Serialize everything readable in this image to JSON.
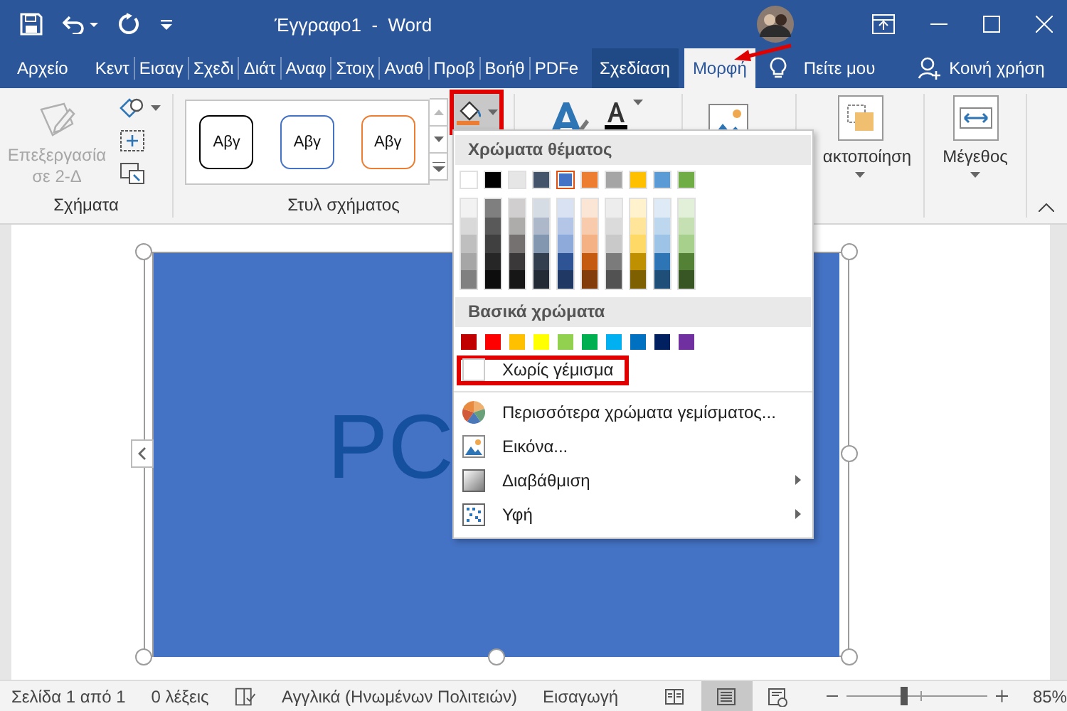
{
  "title_bar": {
    "title": "Έγγραφο1  -  Word"
  },
  "tabs": [
    {
      "label": "Αρχείο",
      "kind": "file",
      "selected": false
    },
    {
      "label": "Κεντ",
      "kind": "normal",
      "selected": false
    },
    {
      "label": "Εισαγ",
      "kind": "normal",
      "selected": false
    },
    {
      "label": "Σχεδι",
      "kind": "normal",
      "selected": false
    },
    {
      "label": "Διάτ",
      "kind": "normal",
      "selected": false
    },
    {
      "label": "Αναφ",
      "kind": "normal",
      "selected": false
    },
    {
      "label": "Στοιχ",
      "kind": "normal",
      "selected": false
    },
    {
      "label": "Αναθ",
      "kind": "normal",
      "selected": false
    },
    {
      "label": "Προβ",
      "kind": "normal",
      "selected": false
    },
    {
      "label": "Βοήθ",
      "kind": "normal",
      "selected": false
    },
    {
      "label": "PDFe",
      "kind": "normal",
      "selected": false
    },
    {
      "label": "Σχεδίαση",
      "kind": "contextual",
      "selected": false
    },
    {
      "label": "Μορφή",
      "kind": "contextual",
      "selected": true
    }
  ],
  "tell_me": {
    "label": "Πείτε μου"
  },
  "share": {
    "label": "Κοινή χρήση"
  },
  "ribbon": {
    "shapes_group": {
      "label": "Σχήματα",
      "edit_button": {
        "label": "Επεξεργασία σε 2-Δ",
        "disabled": true
      }
    },
    "styles_group": {
      "label": "Στυλ σχήματος",
      "styles": [
        {
          "text": "Αβγ",
          "color": "#000000"
        },
        {
          "text": "Αβγ",
          "color": "#4472c4"
        },
        {
          "text": "Αβγ",
          "color": "#ed7d31"
        }
      ],
      "fill_button": {
        "annotated": true
      }
    },
    "arrange": {
      "label": "ακτοποίηση"
    },
    "size": {
      "label": "Μέγεθος"
    }
  },
  "document": {
    "shape_text": "PC"
  },
  "fill_menu": {
    "theme_header": "Χρώματα θέματος",
    "theme_colors": [
      {
        "color": "#ffffff",
        "selected": false,
        "shades": [
          {
            "color": "#f2f2f2"
          },
          {
            "color": "#d9d9d9"
          },
          {
            "color": "#bfbfbf"
          },
          {
            "color": "#a6a6a6"
          },
          {
            "color": "#808080"
          }
        ]
      },
      {
        "color": "#000000",
        "selected": false,
        "shades": [
          {
            "color": "#7f7f7f"
          },
          {
            "color": "#595959"
          },
          {
            "color": "#404040"
          },
          {
            "color": "#262626"
          },
          {
            "color": "#0d0d0d"
          }
        ]
      },
      {
        "color": "#e7e6e6",
        "selected": false,
        "shades": [
          {
            "color": "#d0cece"
          },
          {
            "color": "#aeabab"
          },
          {
            "color": "#767171"
          },
          {
            "color": "#3a3838"
          },
          {
            "color": "#171616"
          }
        ]
      },
      {
        "color": "#44546a",
        "selected": false,
        "shades": [
          {
            "color": "#d6dce4"
          },
          {
            "color": "#adb9ca"
          },
          {
            "color": "#8497b0"
          },
          {
            "color": "#333f4f"
          },
          {
            "color": "#222a35"
          }
        ]
      },
      {
        "color": "#4472c4",
        "selected": true,
        "shades": [
          {
            "color": "#d9e2f3"
          },
          {
            "color": "#b4c6e7"
          },
          {
            "color": "#8eaadb"
          },
          {
            "color": "#2f5496"
          },
          {
            "color": "#1f3864"
          }
        ]
      },
      {
        "color": "#ed7d31",
        "selected": false,
        "shades": [
          {
            "color": "#fbe5d5"
          },
          {
            "color": "#f7cbac"
          },
          {
            "color": "#f4b183"
          },
          {
            "color": "#c55a11"
          },
          {
            "color": "#833c0b"
          }
        ]
      },
      {
        "color": "#a5a5a5",
        "selected": false,
        "shades": [
          {
            "color": "#ededed"
          },
          {
            "color": "#dbdbdb"
          },
          {
            "color": "#c9c9c9"
          },
          {
            "color": "#7b7b7b"
          },
          {
            "color": "#525252"
          }
        ]
      },
      {
        "color": "#ffc000",
        "selected": false,
        "shades": [
          {
            "color": "#fff2cc"
          },
          {
            "color": "#ffe599"
          },
          {
            "color": "#ffd966"
          },
          {
            "color": "#bf9000"
          },
          {
            "color": "#7f6000"
          }
        ]
      },
      {
        "color": "#5b9bd5",
        "selected": false,
        "shades": [
          {
            "color": "#deebf6"
          },
          {
            "color": "#bdd7ee"
          },
          {
            "color": "#9dc3e6"
          },
          {
            "color": "#2e75b5"
          },
          {
            "color": "#1f4e79"
          }
        ]
      },
      {
        "color": "#70ad47",
        "selected": false,
        "shades": [
          {
            "color": "#e2efd9"
          },
          {
            "color": "#c5e0b3"
          },
          {
            "color": "#a8d08d"
          },
          {
            "color": "#538135"
          },
          {
            "color": "#375623"
          }
        ]
      }
    ],
    "standard_header": "Βασικά χρώματα",
    "standard_colors": [
      {
        "color": "#c00000"
      },
      {
        "color": "#ff0000"
      },
      {
        "color": "#ffc000"
      },
      {
        "color": "#ffff00"
      },
      {
        "color": "#92d050"
      },
      {
        "color": "#00b050"
      },
      {
        "color": "#00b0f0"
      },
      {
        "color": "#0070c0"
      },
      {
        "color": "#002060"
      },
      {
        "color": "#7030a0"
      }
    ],
    "items": [
      {
        "kind": "no-fill",
        "label": "Χωρίς γέμισμα",
        "annotated": true,
        "submenu": false
      },
      {
        "kind": "more-colors",
        "label": "Περισσότερα χρώματα γεμίσματος...",
        "annotated": false,
        "submenu": false
      },
      {
        "kind": "picture",
        "label": "Εικόνα...",
        "annotated": false,
        "submenu": false
      },
      {
        "kind": "gradient",
        "label": "Διαβάθμιση",
        "annotated": false,
        "submenu": true
      },
      {
        "kind": "texture",
        "label": "Υφή",
        "annotated": false,
        "submenu": true
      }
    ]
  },
  "status_bar": {
    "page": "Σελίδα 1 από 1",
    "words": "0 λέξεις",
    "language": "Αγγλικά (Ηνωμένων Πολιτειών)",
    "mode": "Εισαγωγή",
    "views": [
      {
        "kind": "read",
        "selected": false
      },
      {
        "kind": "print",
        "selected": true
      },
      {
        "kind": "web",
        "selected": false
      }
    ],
    "zoom": {
      "level": 0.4,
      "reading": "85%"
    }
  }
}
